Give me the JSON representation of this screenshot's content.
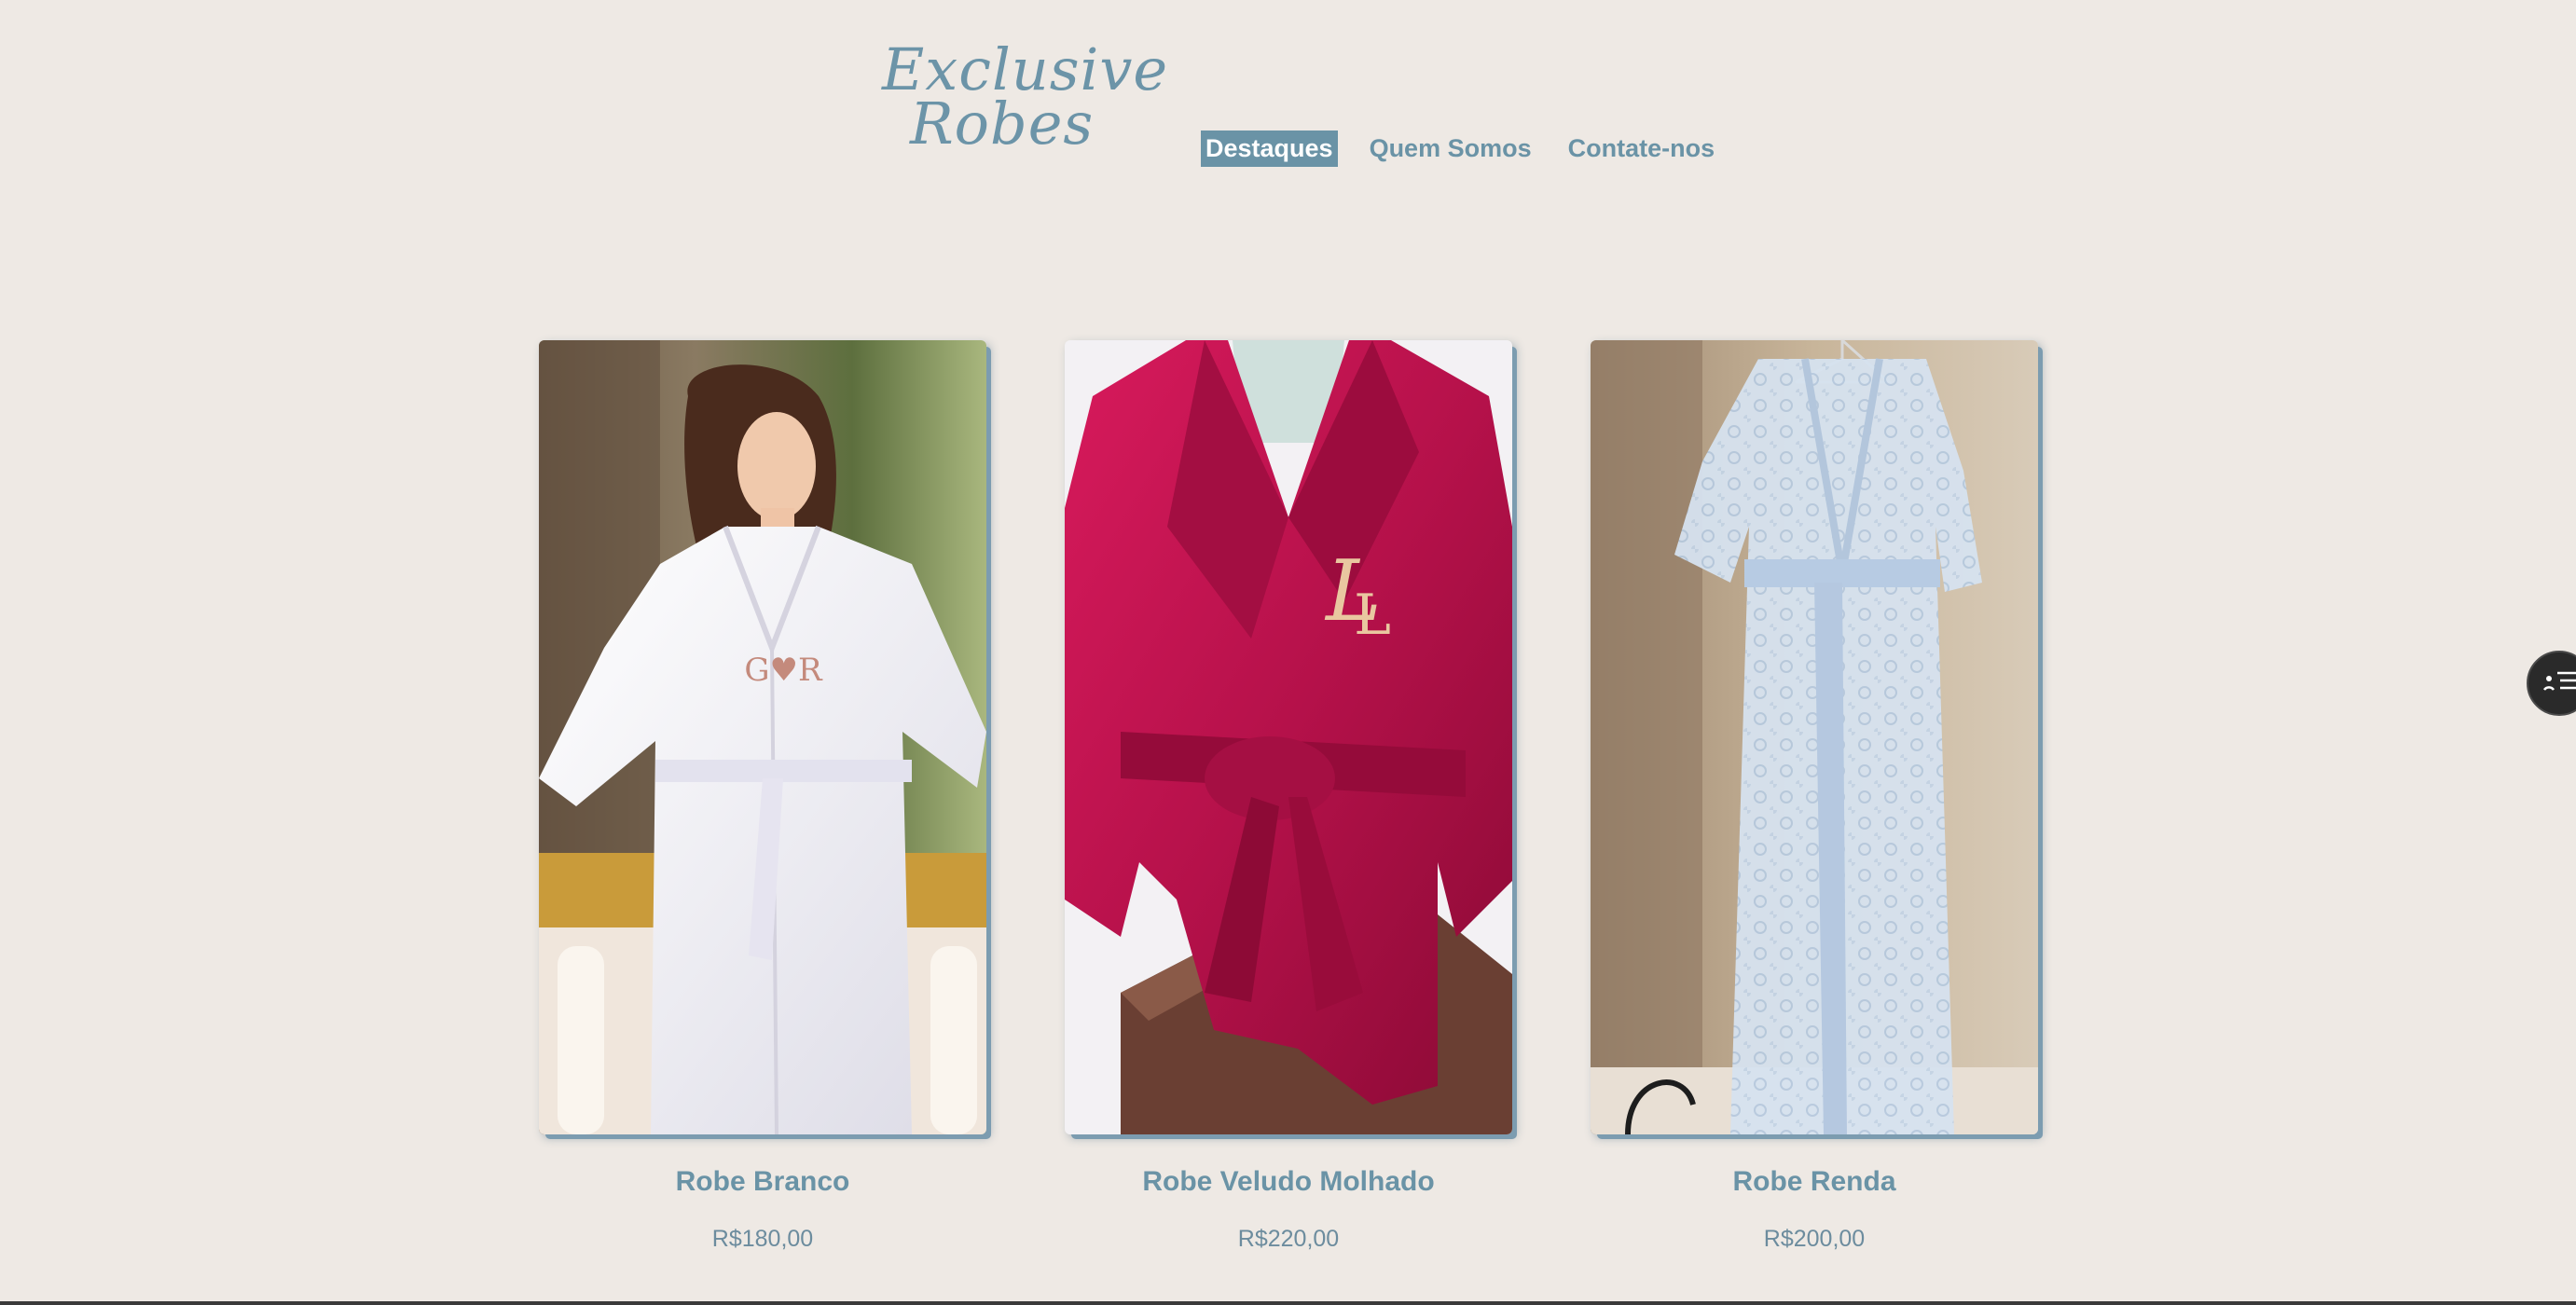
{
  "brand": {
    "logo_line1": "Exclusive",
    "logo_line2": "Robes"
  },
  "nav": {
    "items": [
      {
        "label": "Destaques",
        "active": true
      },
      {
        "label": "Quem Somos",
        "active": false
      },
      {
        "label": "Contate-nos",
        "active": false
      }
    ]
  },
  "products": [
    {
      "name": "Robe Branco",
      "price": "R$180,00",
      "robe_color": "#f4f3f7",
      "monogram": "G♥R"
    },
    {
      "name": "Robe Veludo Molhado",
      "price": "R$220,00",
      "robe_color": "#c0134f",
      "monogram": "LL"
    },
    {
      "name": "Robe Renda",
      "price": "R$200,00",
      "robe_color": "#cfdceb",
      "monogram": ""
    }
  ],
  "floating_button": {
    "icon": "accessibility-menu-icon"
  },
  "colors": {
    "background": "#eee9e4",
    "accent": "#6a93a6",
    "price_text": "#6c8c9e"
  }
}
